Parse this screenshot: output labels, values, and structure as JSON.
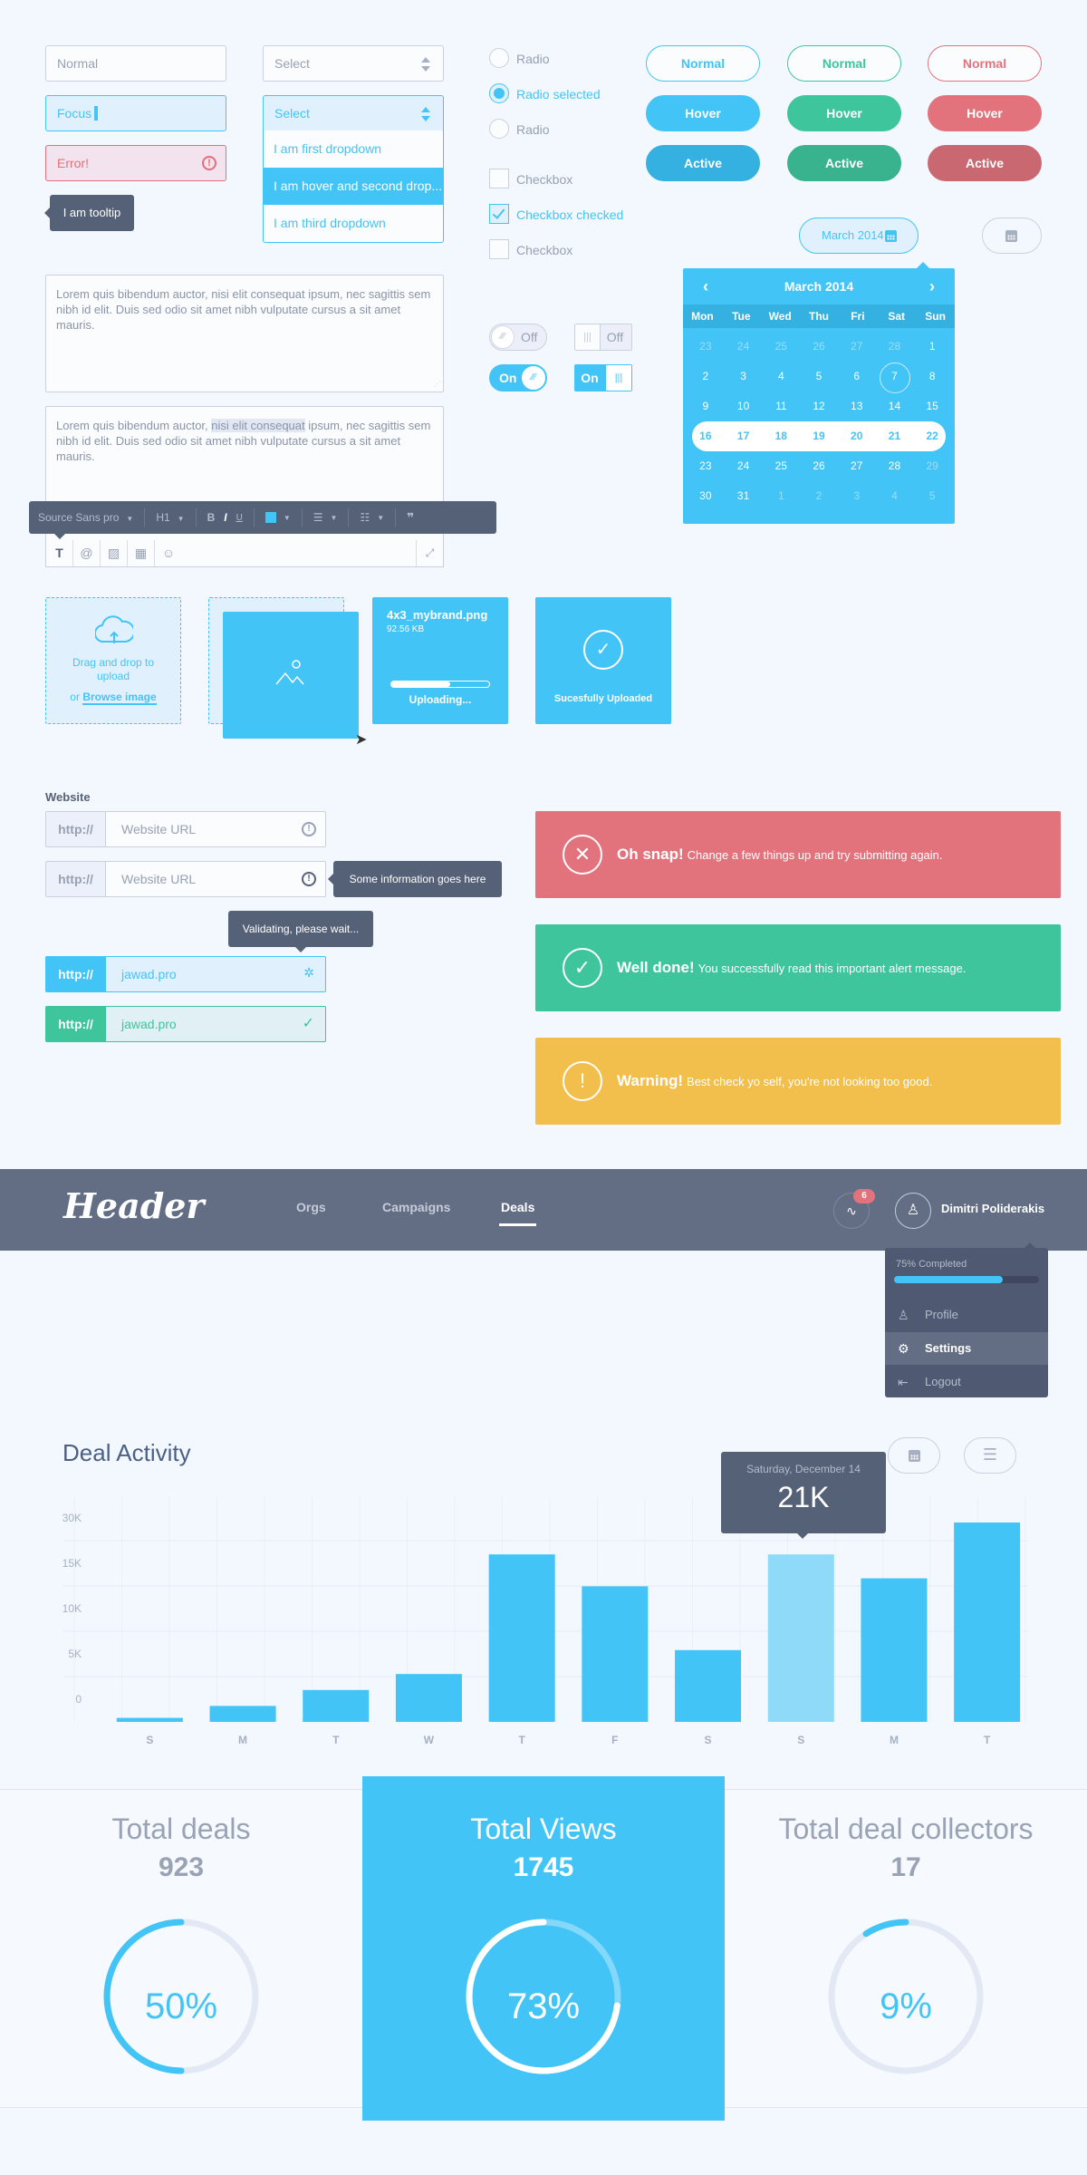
{
  "colors": {
    "primary": "#42c4f7",
    "success": "#3ec59c",
    "danger": "#e2737d",
    "warning": "#f3bf4c",
    "dark": "#556177",
    "header": "#636e85"
  },
  "inputs": {
    "normal": "Normal",
    "focus": "Focus",
    "error": "Error!"
  },
  "tooltip": "I am tooltip",
  "select": {
    "normal": "Select",
    "open": "Select",
    "options": [
      "I am first dropdown",
      "I am hover and second drop...",
      "I am third dropdown"
    ]
  },
  "radios": [
    {
      "label": "Radio",
      "checked": false
    },
    {
      "label": "Radio selected",
      "checked": true
    },
    {
      "label": "Radio",
      "checked": false
    }
  ],
  "checkboxes": [
    {
      "label": "Checkbox",
      "checked": false
    },
    {
      "label": "Checkbox checked",
      "checked": true
    },
    {
      "label": "Checkbox",
      "checked": false
    }
  ],
  "buttons": {
    "normal": "Normal",
    "hover": "Hover",
    "active": "Active"
  },
  "toggles": {
    "off": "Off",
    "on": "On"
  },
  "date": {
    "value": "March 2014"
  },
  "calendar": {
    "title": "March 2014",
    "prev": "‹",
    "next": "›",
    "dow": [
      "Mon",
      "Tue",
      "Wed",
      "Thu",
      "Fri",
      "Sat",
      "Sun"
    ],
    "weeks": [
      [
        "23",
        "24",
        "25",
        "26",
        "27",
        "28",
        "1"
      ],
      [
        "2",
        "3",
        "4",
        "5",
        "6",
        "7",
        "8"
      ],
      [
        "9",
        "10",
        "11",
        "12",
        "13",
        "14",
        "15"
      ],
      [
        "16",
        "17",
        "18",
        "19",
        "20",
        "21",
        "22"
      ],
      [
        "23",
        "24",
        "25",
        "26",
        "27",
        "28",
        "29"
      ],
      [
        "30",
        "31",
        "1",
        "2",
        "3",
        "4",
        "5"
      ]
    ],
    "today": "7",
    "selected_week": 3
  },
  "textarea": {
    "text": "Lorem quis bibendum auctor, nisi elit consequat ipsum, nec sagittis sem nibh id elit. Duis sed odio sit amet nibh vulputate cursus a sit amet mauris.",
    "before": "Lorem quis bibendum auctor, ",
    "selected": "nisi elit consequat",
    "after": " ipsum, nec sagittis sem nibh id elit. Duis sed odio sit amet nibh vulputate cursus a sit amet mauris."
  },
  "editor": {
    "font": "Source Sans pro",
    "heading": "H1",
    "bold": "B",
    "italic": "I",
    "underline": "U",
    "quote": "❞"
  },
  "upload": {
    "drag_text": "Drag and drop to upload",
    "or": "or",
    "browse": "Browse image",
    "file_name": "4x3_mybrand.png",
    "file_size": "92.56 KB",
    "progress": 0.6,
    "uploading": "Uploading...",
    "success": "Sucesfully Uploaded"
  },
  "website": {
    "label": "Website",
    "prefix": "http://",
    "placeholder": "Website URL",
    "info_tip": "Some information goes here",
    "validating_tip": "Validating, please wait...",
    "value": "jawad.pro"
  },
  "alerts": [
    {
      "type": "danger",
      "title": "Oh snap!",
      "text": "Change a few things up and try submitting again."
    },
    {
      "type": "success",
      "title": "Well done!",
      "text": "You successfully read this important alert message."
    },
    {
      "type": "warning",
      "title": "Warning!",
      "text": "Best check yo self, you're not looking too good."
    }
  ],
  "header": {
    "logo": "Header",
    "nav": [
      "Orgs",
      "Campaigns",
      "Deals"
    ],
    "active_nav": "Deals",
    "notifications": "6",
    "user": "Dimitri Poliderakis",
    "dropdown": {
      "progress_label": "75% Completed",
      "progress": 0.75,
      "items": [
        "Profile",
        "Settings",
        "Logout"
      ],
      "active": "Settings"
    }
  },
  "chart_data": {
    "type": "bar",
    "title": "Deal Activity",
    "categories": [
      "S",
      "M",
      "T",
      "W",
      "T",
      "F",
      "S",
      "S",
      "M",
      "T"
    ],
    "values": [
      500,
      2000,
      4000,
      6000,
      21000,
      17000,
      9000,
      21000,
      18000,
      25000
    ],
    "highlighted_index": 7,
    "y_ticks": [
      "30K",
      "15K",
      "10K",
      "5K",
      "0"
    ],
    "ylim": [
      0,
      30000
    ],
    "grid": true,
    "tooltip": {
      "date": "Saturday, December 14",
      "value": "21K"
    },
    "xlabel": "",
    "ylabel": ""
  },
  "stats": [
    {
      "label": "Total deals",
      "value": "923",
      "percent": 50,
      "featured": false
    },
    {
      "label": "Total Views",
      "value": "1745",
      "percent": 73,
      "featured": true
    },
    {
      "label": "Total deal collectors",
      "value": "17",
      "percent": 9,
      "featured": false
    }
  ]
}
